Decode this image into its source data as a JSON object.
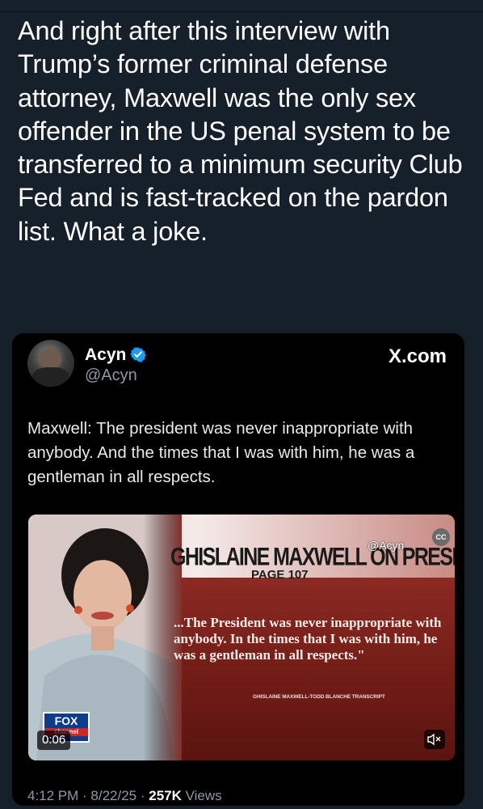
{
  "post": {
    "text": "And right after this interview with Trump’s former criminal defense attorney, Maxwell was the only sex offender in the US penal system to be transferred to a minimum security Club Fed and is fast-tracked on the pardon list. What a joke."
  },
  "quoted_tweet": {
    "author_name": "Acyn",
    "handle": "@Acyn",
    "site": "X.com",
    "text": "Maxwell: The president was never inappropriate with anybody. And the times that I was with him, he was a gentleman in all respects.",
    "timestamp": "4:12 PM · 8/22/25 · ",
    "views_count": "257K",
    "views_label": " Views",
    "video": {
      "headline": "GHISLAINE MAXWELL ON PRESIDENT TRUMP",
      "page": "PAGE 107",
      "quote": "...The President was never inappropriate with anybody. In the times that I was with him, he was a gentleman in all respects.\"",
      "credit": "GHISLAINE MAXWELL-TODD BLANCHE TRANSCRIPT",
      "watermark": "@Acyn",
      "cc_label": "CC",
      "logo_top": "FOX",
      "logo_mid": "NEWS",
      "logo_bottom": "channel",
      "duration": "0:06"
    }
  },
  "colors": {
    "background": "#15202b",
    "card": "#000000",
    "verified": "#1d9bf0",
    "muted_text": "#8b98a5"
  },
  "icons": [
    "verified-badge-icon",
    "closed-captions-icon",
    "volume-muted-icon"
  ]
}
